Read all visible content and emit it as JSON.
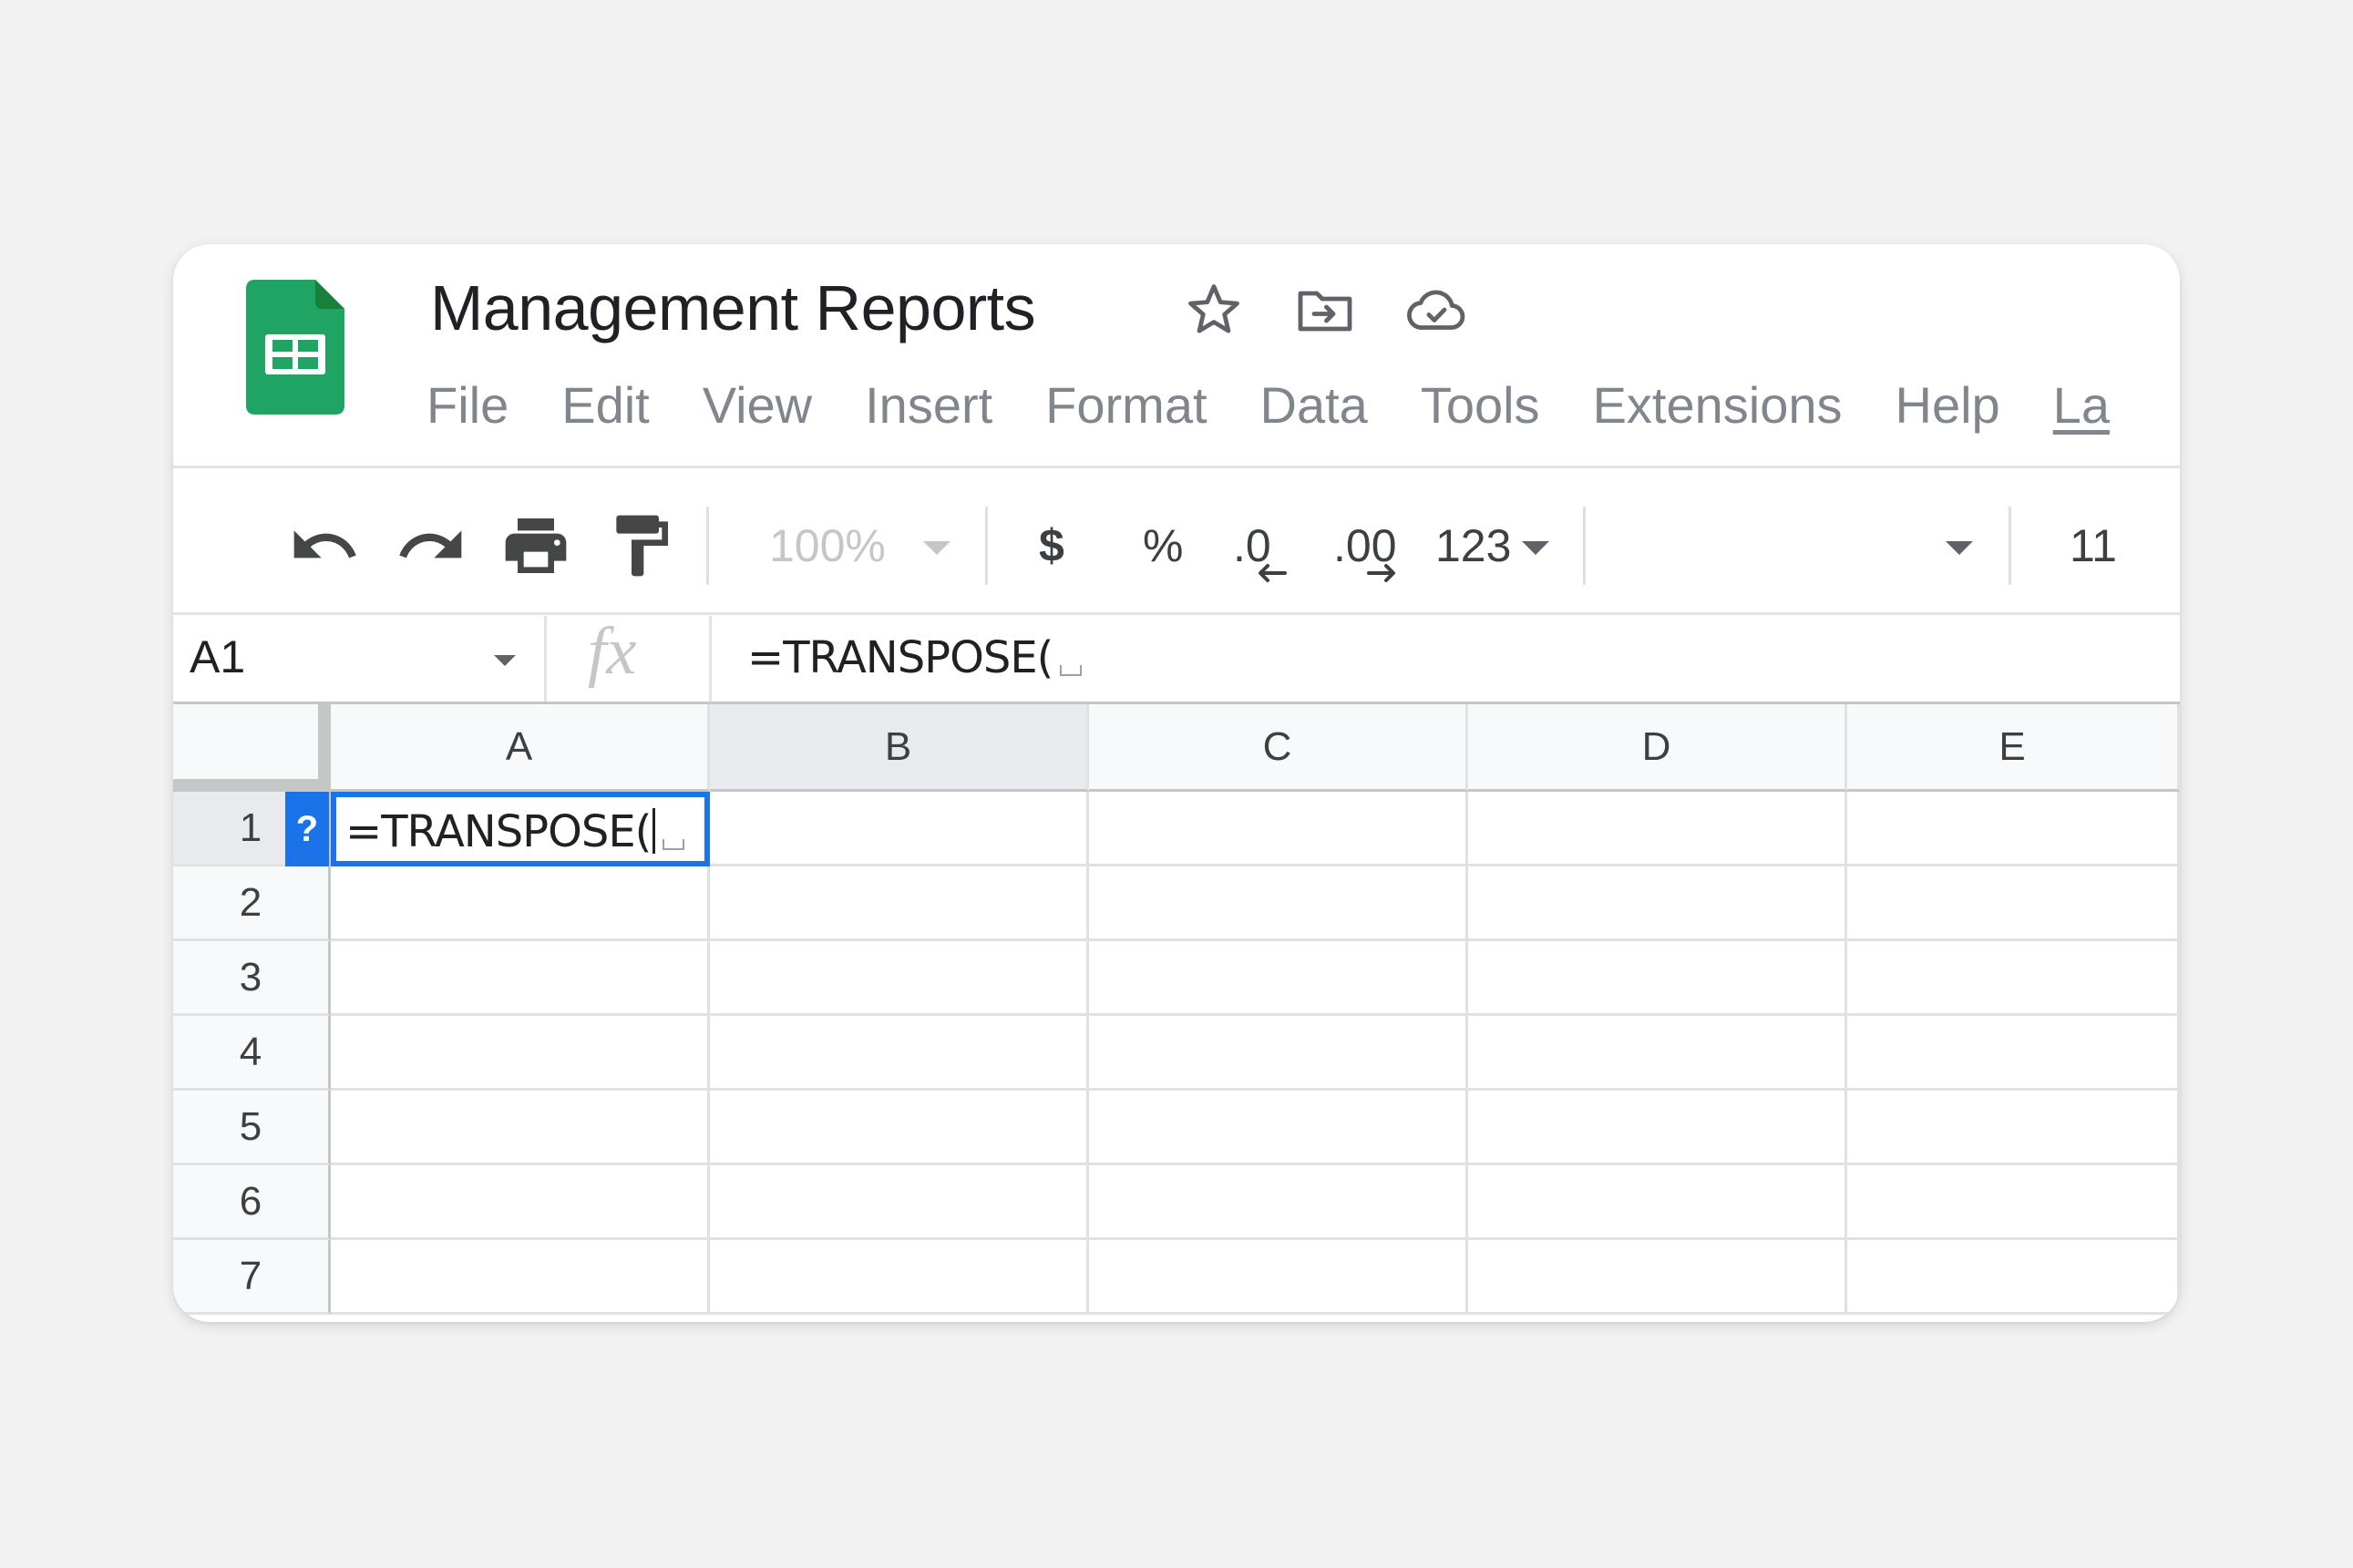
{
  "app": {
    "title": "Management Reports",
    "accent_color": "#1a73e8",
    "logo_color": "#1fa463",
    "icons": [
      "sheets-logo-icon",
      "star-icon",
      "move-to-folder-icon",
      "cloud-saved-icon"
    ]
  },
  "menu": [
    "File",
    "Edit",
    "View",
    "Insert",
    "Format",
    "Data",
    "Tools",
    "Extensions",
    "Help",
    "La"
  ],
  "toolbar": {
    "icons": [
      "undo-icon",
      "redo-icon",
      "print-icon",
      "paint-format-icon"
    ],
    "zoom": "100%",
    "currency": "$",
    "percent": "%",
    "decrease_decimal": ".0",
    "increase_decimal": ".00",
    "more_formats": "123",
    "font_size": "11"
  },
  "formula_bar": {
    "name_box": "A1",
    "fx_label": "fx",
    "formula": "=TRANSPOSE("
  },
  "grid": {
    "columns": [
      "A",
      "B",
      "C",
      "D",
      "E"
    ],
    "rows": [
      "1",
      "2",
      "3",
      "4",
      "5",
      "6",
      "7"
    ],
    "active_cell": "A1",
    "active_cell_text": "=TRANSPOSE(",
    "help_badge": "?"
  }
}
